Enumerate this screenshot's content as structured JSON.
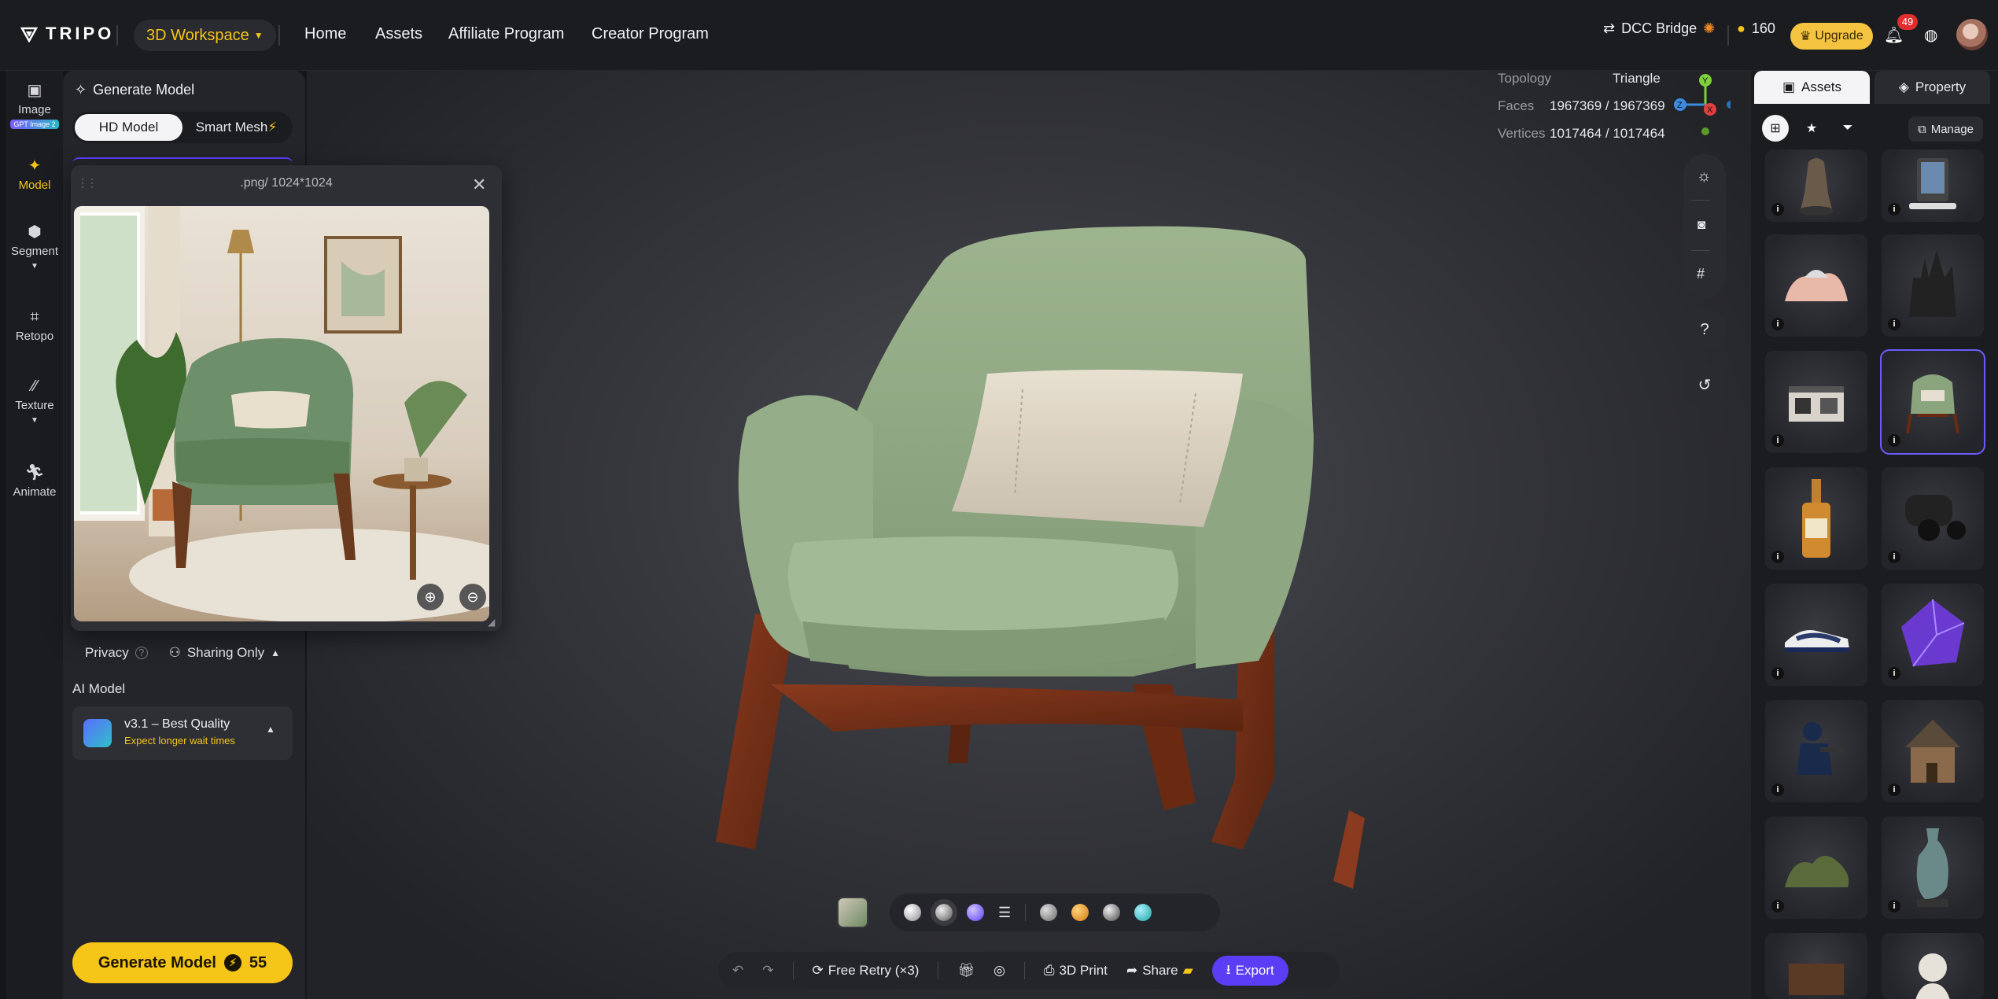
{
  "app": {
    "logo": "TRIPO",
    "workspace_label": "3D Workspace",
    "nav": [
      "Home",
      "Assets",
      "Affiliate Program",
      "Creator Program"
    ],
    "dcc_bridge": "DCC Bridge",
    "credits": "160",
    "upgrade": "Upgrade",
    "notifications": "49"
  },
  "rail": [
    {
      "label": "Image",
      "chip": "GPT Image 2",
      "icon": "image-icon"
    },
    {
      "label": "Model",
      "icon": "sparkle-icon",
      "active": true
    },
    {
      "label": "Segment",
      "icon": "cube-icon"
    },
    {
      "label": "Retopo",
      "icon": "mesh-icon"
    },
    {
      "label": "Texture",
      "icon": "brush-icon"
    },
    {
      "label": "Animate",
      "icon": "figure-icon"
    }
  ],
  "panel": {
    "title": "Generate Model",
    "modes": [
      "HD Model",
      "Smart Mesh"
    ],
    "popup_title": ".png/ 1024*1024",
    "privacy_label": "Privacy",
    "privacy_value": "Sharing Only",
    "ai_model_label": "AI Model",
    "ai_model_name": "v3.1 – Best Quality",
    "ai_model_note": "Expect longer wait times",
    "generate_label": "Generate Model",
    "generate_cost": "55"
  },
  "stats": {
    "topology_label": "Topology",
    "topology_value": "Triangle",
    "faces_label": "Faces",
    "faces_value": "1967369 / 1967369",
    "vertices_label": "Vertices",
    "vertices_value": "1017464 / 1017464"
  },
  "axes": {
    "x": "X",
    "y": "Y",
    "z": "Z"
  },
  "actions": {
    "free_retry": "Free Retry (×3)",
    "print": "3D Print",
    "share": "Share",
    "export": "Export"
  },
  "right": {
    "tab_assets": "Assets",
    "tab_property": "Property",
    "manage": "Manage"
  },
  "colors": {
    "accent": "#f5c518",
    "export": "#5b3df5",
    "selected": "#6b5bff"
  }
}
